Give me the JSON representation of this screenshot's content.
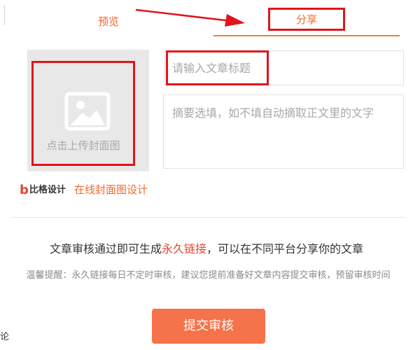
{
  "tabs": {
    "preview_label": "预览",
    "share_label": "分享"
  },
  "cover": {
    "upload_label": "点击上传封面图",
    "icon": "image-icon"
  },
  "form": {
    "title_placeholder": "请输入文章标题",
    "title_value": "",
    "summary_placeholder": "摘要选填，如不填自动摘取正文里的文字",
    "summary_value": ""
  },
  "brand": {
    "logo_b": "b",
    "logo_text": "比格设计",
    "link_text": "在线封面图设计"
  },
  "notice": {
    "before": "文章审核通过即可生成",
    "accent": "永久链接",
    "after": "，可以在不同平台分享你的文章"
  },
  "tip": "温馨提醒：永久链接每日不定时审核，建议您提前准备好文章内容提交审核，预留审核时间",
  "submit_label": "提交审核",
  "edge_char": "论",
  "colors": {
    "accent": "#f0682d",
    "highlight": "#e0141b",
    "button": "#f5734a"
  }
}
